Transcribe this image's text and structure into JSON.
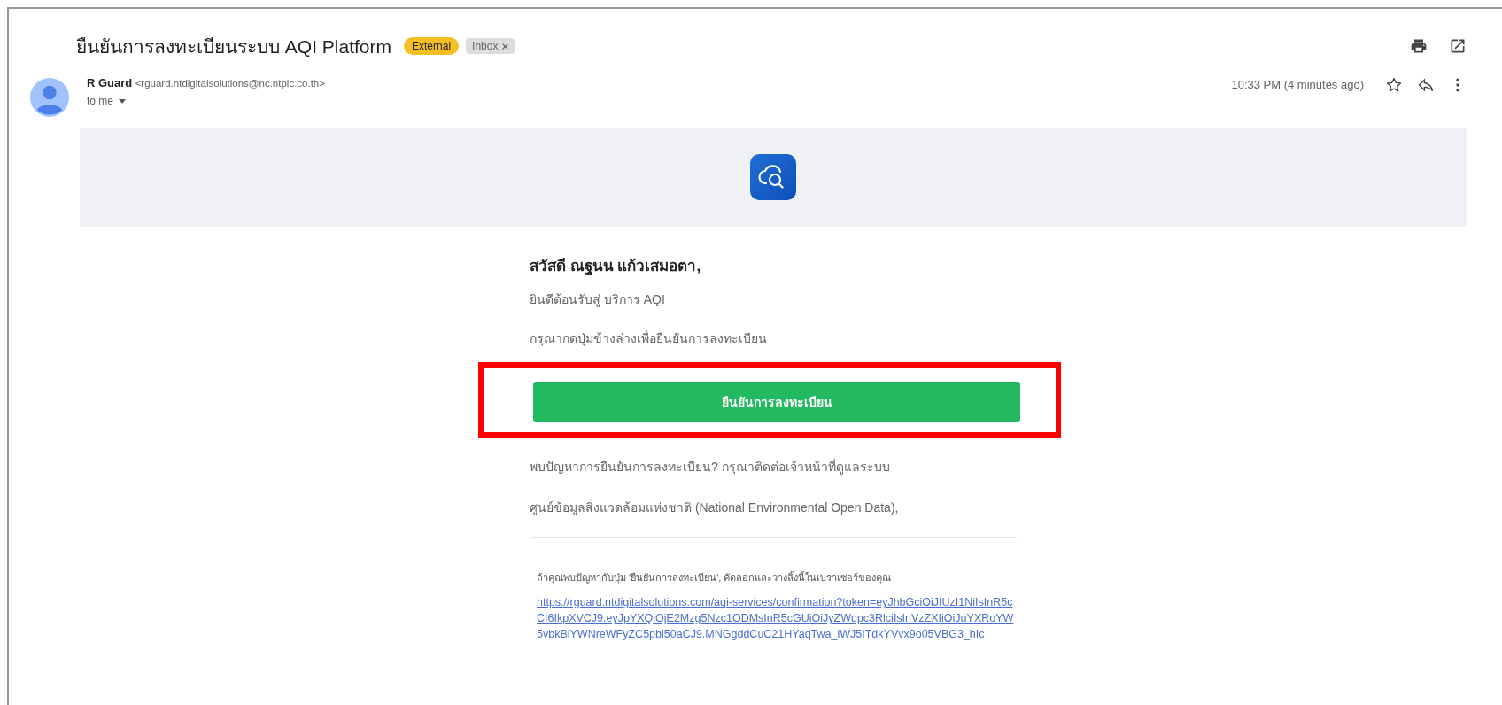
{
  "subject": "ยืนยันการลงทะเบียนระบบ AQI Platform",
  "labels": [
    {
      "text": "External",
      "kind": "external",
      "removable": false
    },
    {
      "text": "Inbox",
      "kind": "inbox",
      "removable": true
    }
  ],
  "sender": {
    "name": "R Guard",
    "email": "<rguard.ntdigitalsolutions@nc.ntplc.co.th>",
    "recipient": "to me"
  },
  "time": "10:33 PM (4 minutes ago)",
  "starred": false,
  "body": {
    "greeting": "สวัสดี ณฐนน แก้วเสมอตา,",
    "welcome": "ยินดีต้อนรับสู่ บริการ AQI",
    "instruction": "กรุณากดปุ่มข้างล่างเพื่อยืนยันการลงทะเบียน",
    "button": "ยืนยันการลงทะเบียน",
    "help_line_1": "พบปัญหาการยืนยันการลงทะเบียน? กรุณาติดต่อเจ้าหน้าที่ดูแลระบบ",
    "help_line_2": "ศูนย์ข้อมูลสิ่งแวดล้อมแห่งชาติ (National Environmental Open Data),",
    "fallback_note": "ถ้าคุณพบปัญหากับปุ่ม 'ยืนยันการลงทะเบียน', คัดลอกและวางลิ้งนี้ในเบราเซอร์ของคุณ",
    "link": "https://rguard.ntdigitalsolutions.com/aqi-services/confirmation?token=eyJhbGciOiJIUzI1NiIsInR5cCI6IkpXVCJ9.eyJpYXQiOjE2Mzg5Nzc1ODMsInR5cGUiOiJyZWdpc3RlciIsInVzZXIiOiJuYXRoYW5vbkBiYWNreWFyZC5pbi50aCJ9.MNGgddCuC21HYaqTwa_iWJ5ITdkYVvx9o05VBG3_hIc"
  }
}
